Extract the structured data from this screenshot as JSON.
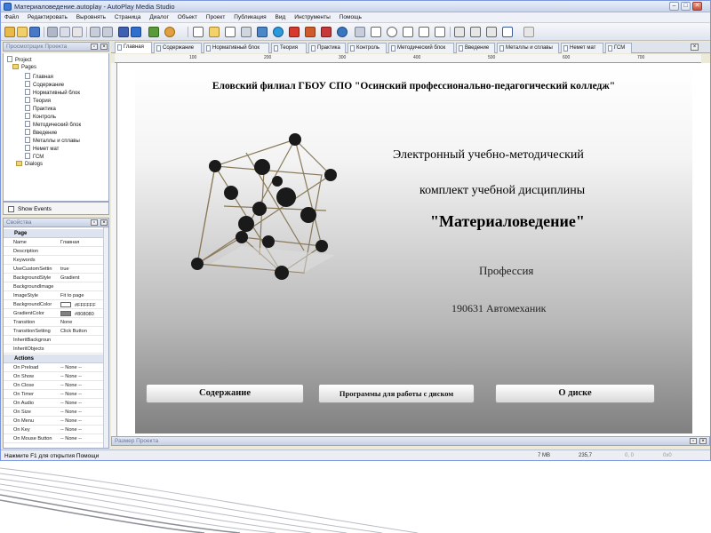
{
  "window": {
    "title": "Материаловедение.autoplay - AutoPlay Media Studio",
    "min": "–",
    "max": "□",
    "close": "✕"
  },
  "menu": [
    "Файл",
    "Редактировать",
    "Выровнять",
    "Страница",
    "Диалог",
    "Объект",
    "Проект",
    "Публикация",
    "Вид",
    "Инструменты",
    "Помощь"
  ],
  "panels": {
    "project_title": "Просмотрщик Проекта",
    "properties_title": "Свойства",
    "project_size_title": "Размер Проекта",
    "show_events": "Show Events"
  },
  "tree": {
    "root": "Project",
    "pages_folder": "Pages",
    "pages": [
      "Главная",
      "Содержание",
      "Нормативный блок",
      "Теория",
      "Практика",
      "Контроль",
      "Методический блок",
      "Введение",
      "Металлы и сплавы",
      "Немет мат",
      "ГСМ"
    ],
    "dialogs": "Dialogs"
  },
  "properties": {
    "page_category": "Page",
    "rows": [
      {
        "key": "Name",
        "value": "Главная"
      },
      {
        "key": "Description",
        "value": ""
      },
      {
        "key": "Keywords",
        "value": ""
      },
      {
        "key": "UseCustomSettin",
        "value": "true"
      },
      {
        "key": "BackgroundStyle",
        "value": "Gradient"
      },
      {
        "key": "BackgroundImage",
        "value": ""
      },
      {
        "key": "ImageStyle",
        "value": "Fit to page"
      },
      {
        "key": "BackgroundColor",
        "value": "#FFFFFF",
        "swatch": "#ffffff"
      },
      {
        "key": "GradientColor",
        "value": "#808080",
        "swatch": "#808080"
      },
      {
        "key": "Transition",
        "value": "None"
      },
      {
        "key": "TransitionSetting",
        "value": "Click Button"
      },
      {
        "key": "InheritBackgroun",
        "value": ""
      },
      {
        "key": "InheritObjects",
        "value": ""
      }
    ],
    "actions_category": "Actions",
    "actions": [
      {
        "key": "On Preload",
        "value": "-- None --"
      },
      {
        "key": "On Show",
        "value": "-- None --"
      },
      {
        "key": "On Close",
        "value": "-- None --"
      },
      {
        "key": "On Timer",
        "value": "-- None --"
      },
      {
        "key": "On Audio",
        "value": "-- None --"
      },
      {
        "key": "On Size",
        "value": "-- None --"
      },
      {
        "key": "On Menu",
        "value": "-- None --"
      },
      {
        "key": "On Key",
        "value": "-- None --"
      },
      {
        "key": "On Mouse Button",
        "value": "-- None --"
      }
    ]
  },
  "tabs": [
    "Главная",
    "Содержание",
    "Нормативный блок",
    "Теория",
    "Практика",
    "Контроль",
    "Методический блок",
    "Введение",
    "Металлы и сплавы",
    "Немет мат",
    "ГСМ"
  ],
  "active_tab": "Главная",
  "ruler": [
    "100",
    "200",
    "300",
    "400",
    "500",
    "600",
    "700"
  ],
  "page": {
    "header": "Еловский филиал ГБОУ СПО \"Осинский профессионально-педагогический колледж\"",
    "line1": "Электронный учебно-методический",
    "line2": "комплект учебной дисциплины",
    "line3": "\"Материаловедение\"",
    "line4": "Профессия",
    "line5": "190631 Автомеханик",
    "buttons": [
      "Содержание",
      "Программы для работы с диском",
      "О диске"
    ],
    "bg_color": "#FFFFFF",
    "gradient_color": "#808080"
  },
  "status": {
    "hint": "Нажмите F1 для открытия Помощи",
    "memory": "7 MB",
    "zoom": "235,7",
    "c1": "0, 0",
    "c2": "0x0"
  }
}
